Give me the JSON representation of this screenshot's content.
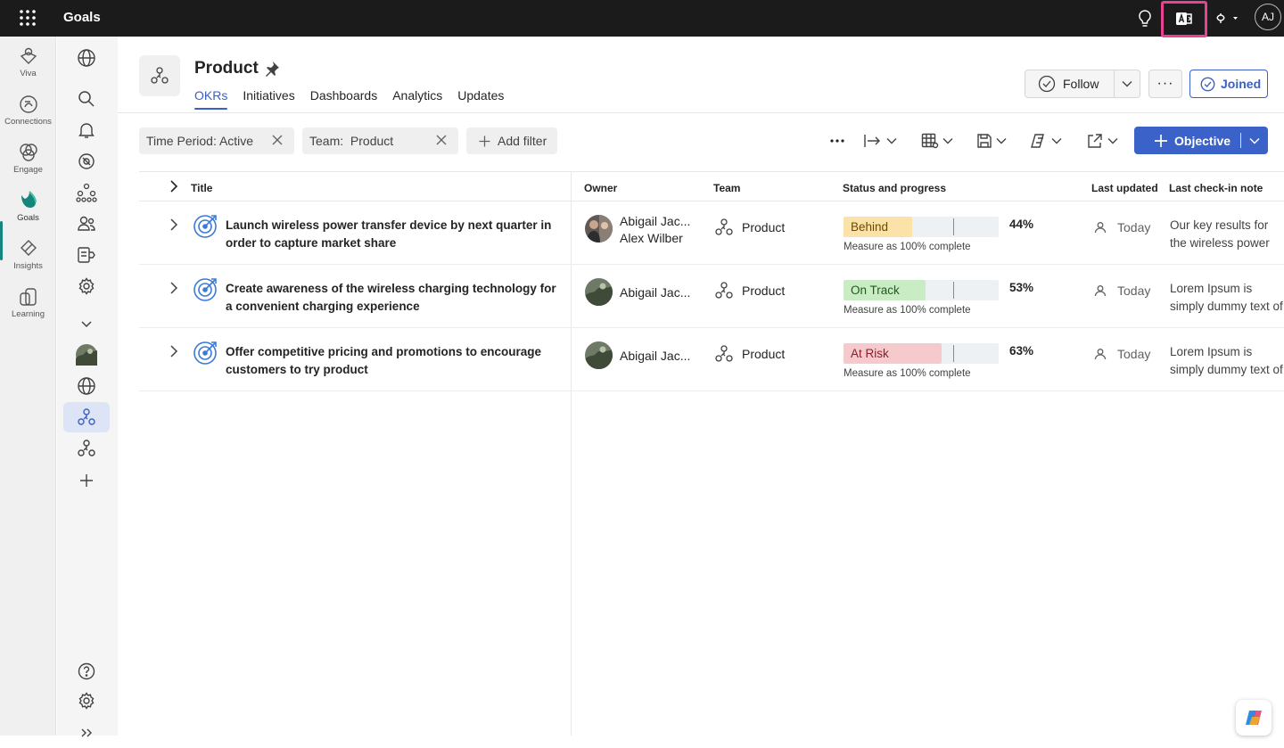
{
  "app": {
    "title": "Goals",
    "user_initials": "AJ"
  },
  "rail": {
    "items": [
      {
        "label": "Viva",
        "icon": "viva-icon"
      },
      {
        "label": "Connections",
        "icon": "connections-icon"
      },
      {
        "label": "Engage",
        "icon": "engage-icon"
      },
      {
        "label": "Goals",
        "icon": "goals-icon"
      },
      {
        "label": "Insights",
        "icon": "insights-icon"
      },
      {
        "label": "Learning",
        "icon": "learning-icon"
      }
    ]
  },
  "header": {
    "title": "Product",
    "tabs": [
      "OKRs",
      "Initiatives",
      "Dashboards",
      "Analytics",
      "Updates"
    ],
    "active_tab": "OKRs",
    "follow_label": "Follow",
    "more_label": "···",
    "joined_label": "Joined"
  },
  "filters": {
    "chips": [
      "Time Period: Active",
      "Team:  Product"
    ],
    "add_filter": "Add filter",
    "objective_label": "Objective"
  },
  "table": {
    "columns": [
      "Title",
      "Owner",
      "Team",
      "Status and progress",
      "Last updated",
      "Last check-in note"
    ],
    "rows": [
      {
        "title": "Launch wireless power transfer device by next quarter in order to capture market share",
        "owners": [
          "Abigail Jac...",
          "Alex Wilber"
        ],
        "team": "Product",
        "status": "Behind",
        "progress": 44,
        "progress_label": "44%",
        "measure": "Measure as 100% complete",
        "updated": "Today",
        "note": "Our key results for the wireless power transfer"
      },
      {
        "title": "Create awareness of the wireless charging technology for a convenient charging experience",
        "owners": [
          "Abigail Jac..."
        ],
        "team": "Product",
        "status": "On Track",
        "progress": 53,
        "progress_label": "53%",
        "measure": "Measure as 100% complete",
        "updated": "Today",
        "note": "Lorem Ipsum is simply dummy text of the printing and typesetting industry"
      },
      {
        "title": "Offer competitive pricing and promotions to encourage customers to try product",
        "owners": [
          "Abigail Jac..."
        ],
        "team": "Product",
        "status": "At Risk",
        "progress": 63,
        "progress_label": "63%",
        "measure": "Measure as 100% complete",
        "updated": "Today",
        "note": "Lorem Ipsum is simply dummy text of the printing and typesetting industry"
      }
    ]
  },
  "colors": {
    "accent": "#3a62c9",
    "behind": "#fbe2a8",
    "on_track": "#c9ecc4",
    "at_risk": "#f6c9cd",
    "goals_active": "#16867d",
    "highlight": "#e84393"
  }
}
